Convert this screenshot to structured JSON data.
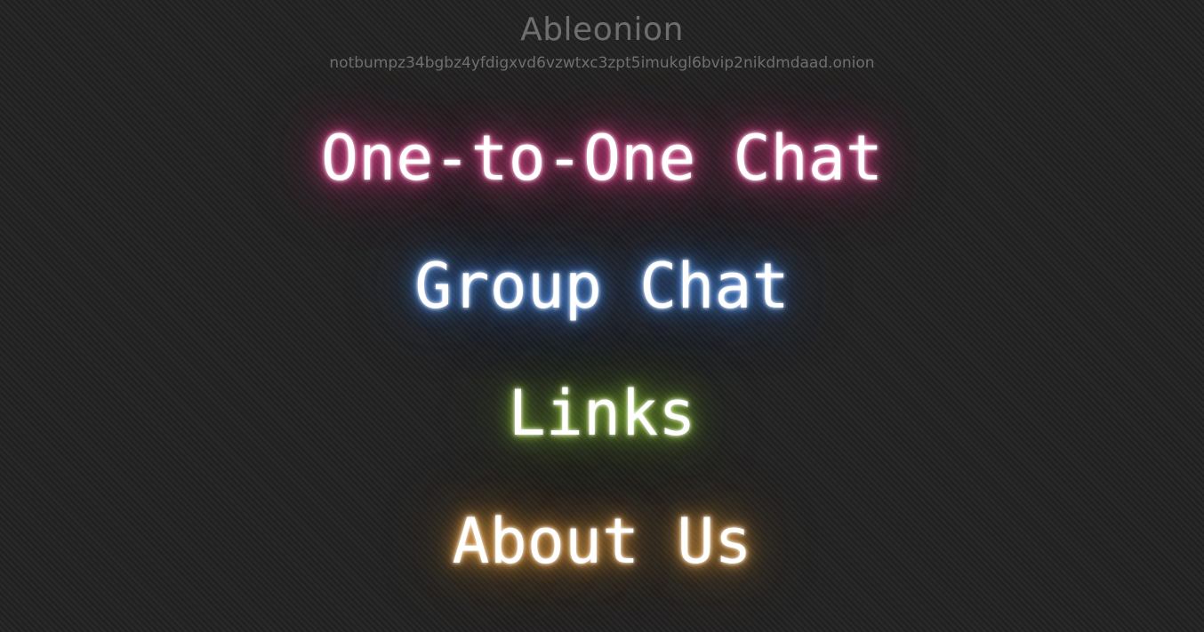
{
  "site": {
    "title": "Ableonion",
    "address": "notbumpz34bgbz4yfdigxvd6vzwtxc3zpt5imukgl6bvip2nikdmdaad.onion"
  },
  "nav": {
    "items": [
      {
        "label": "One-to-One Chat",
        "glow_color": "#e0408a"
      },
      {
        "label": "Group Chat",
        "glow_color": "#3f7fd8"
      },
      {
        "label": "Links",
        "glow_color": "#86b832"
      },
      {
        "label": "About Us",
        "glow_color": "#e09a3c"
      }
    ]
  },
  "colors": {
    "background": "#242424",
    "title_text": "#6e6e6e",
    "link_text": "#ffffff"
  }
}
